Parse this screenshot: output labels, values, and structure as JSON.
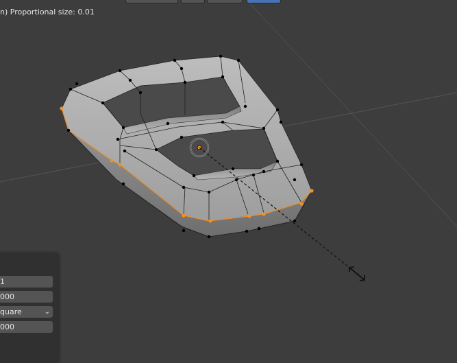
{
  "header": {
    "status_text": "n) Proportional size: 0.01"
  },
  "operator_panel": {
    "field_1": "1",
    "field_2": "000",
    "field_3": "quare",
    "field_4": "000"
  },
  "icons": {
    "proportional_circle": "proportional-falloff-circle-icon",
    "scale_cursor": "scale-arrows-cursor-icon",
    "dropdown": "chevron-down-icon"
  },
  "colors": {
    "background": "#3d3d3d",
    "mesh_surface": "#a8a8a8",
    "selected_vertex": "#f0902a",
    "vertex": "#000000",
    "grid_line": "#555555",
    "panel": "#303030",
    "field": "#545454"
  }
}
